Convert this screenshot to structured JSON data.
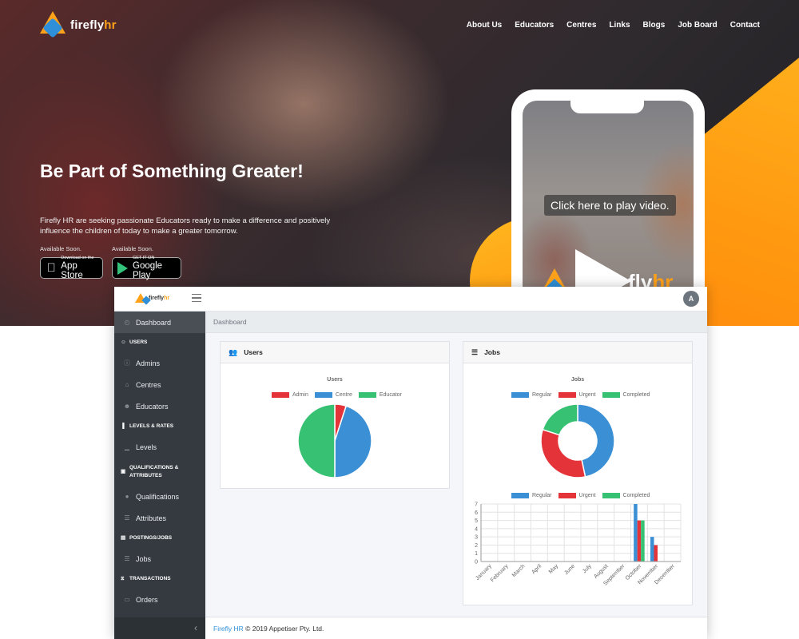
{
  "site": {
    "logo_text": "firefly",
    "logo_text_accent": "hr",
    "nav": [
      "About Us",
      "Educators",
      "Centres",
      "Links",
      "Blogs",
      "Job Board",
      "Contact"
    ],
    "hero_title": "Be Part of Something Greater!",
    "hero_subtitle": "Firefly HR are seeking passionate Educators ready to make a difference and positively influence the children of today to make a greater tomorrow.",
    "appstore": {
      "available": "Available Soon.",
      "small": "Download on the",
      "big": "App Store"
    },
    "googleplay": {
      "available": "Available Soon.",
      "small": "GET IT ON",
      "big": "Google Play"
    },
    "video_label": "Click here to play video.",
    "phone_brand": "fly",
    "phone_brand_accent": "hr"
  },
  "dashboard": {
    "logo_text": "firefly",
    "logo_text_accent": "hr",
    "avatar": "A",
    "breadcrumb": "Dashboard",
    "sidebar": [
      {
        "type": "item",
        "label": "Dashboard",
        "icon": "gauge-icon",
        "active": true
      },
      {
        "type": "head",
        "label": "USERS",
        "icon": "users-icon"
      },
      {
        "type": "item",
        "label": "Admins",
        "icon": "info-icon"
      },
      {
        "type": "item",
        "label": "Centres",
        "icon": "building-icon"
      },
      {
        "type": "item",
        "label": "Educators",
        "icon": "user-icon"
      },
      {
        "type": "head",
        "label": "LEVELS & RATES",
        "icon": "chart-icon"
      },
      {
        "type": "item",
        "label": "Levels",
        "icon": "signal-icon"
      },
      {
        "type": "head",
        "label": "QUALIFICATIONS & ATTRIBUTES",
        "icon": "certificate-icon"
      },
      {
        "type": "item",
        "label": "Qualifications",
        "icon": "circle-icon"
      },
      {
        "type": "item",
        "label": "Attributes",
        "icon": "list-icon"
      },
      {
        "type": "head",
        "label": "POSTINGS/JOBS",
        "icon": "briefcase-icon"
      },
      {
        "type": "item",
        "label": "Jobs",
        "icon": "list-ul-icon"
      },
      {
        "type": "head",
        "label": "TRANSACTIONS",
        "icon": "handshake-icon"
      },
      {
        "type": "item",
        "label": "Orders",
        "icon": "money-icon"
      }
    ],
    "users_card": {
      "title": "Users"
    },
    "jobs_card": {
      "title": "Jobs"
    },
    "footer_link": "Firefly HR",
    "footer_text": " © 2019 Appetiser Pty. Ltd."
  },
  "colors": {
    "red": "#e5333a",
    "blue": "#3b8fd5",
    "green": "#37c172",
    "orange": "#ff9a10"
  },
  "chart_data": [
    {
      "type": "pie",
      "title": "Users",
      "categories": [
        "Admin",
        "Centre",
        "Educator"
      ],
      "values": [
        1,
        9,
        10
      ],
      "colors": [
        "#e5333a",
        "#3b8fd5",
        "#37c172"
      ]
    },
    {
      "type": "pie",
      "subtype": "doughnut",
      "title": "Jobs",
      "categories": [
        "Regular",
        "Urgent",
        "Completed"
      ],
      "values": [
        7,
        5,
        3
      ],
      "colors": [
        "#3b8fd5",
        "#e5333a",
        "#37c172"
      ]
    },
    {
      "type": "bar",
      "categories": [
        "January",
        "February",
        "March",
        "April",
        "May",
        "June",
        "July",
        "August",
        "September",
        "October",
        "November",
        "December"
      ],
      "series": [
        {
          "name": "Regular",
          "color": "#3b8fd5",
          "values": [
            0,
            0,
            0,
            0,
            0,
            0,
            0,
            0,
            0,
            7,
            3,
            0
          ]
        },
        {
          "name": "Urgent",
          "color": "#e5333a",
          "values": [
            0,
            0,
            0,
            0,
            0,
            0,
            0,
            0,
            0,
            5,
            2,
            0
          ]
        },
        {
          "name": "Completed",
          "color": "#37c172",
          "values": [
            0,
            0,
            0,
            0,
            0,
            0,
            0,
            0,
            0,
            5,
            0,
            0
          ]
        }
      ],
      "ylim": [
        0,
        7
      ],
      "grid": true,
      "legend": "top"
    }
  ]
}
